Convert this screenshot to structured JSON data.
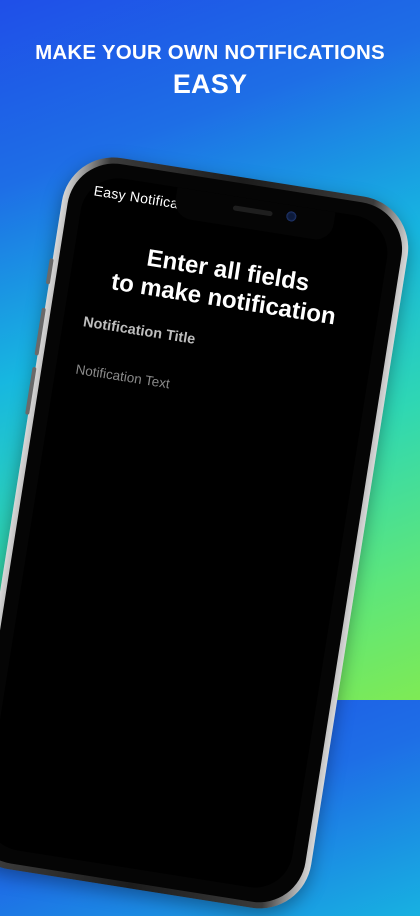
{
  "header": {
    "line1": "MAKE YOUR OWN NOTIFICATIONS",
    "line2": "EASY"
  },
  "app": {
    "title": "Easy Notification",
    "prompt_line1": "Enter all fields",
    "prompt_line2": "to make notification",
    "title_placeholder": "Notification Title",
    "text_placeholder": "Notification Text"
  },
  "colors": {
    "background_top": "#1f4fe8",
    "background_mid": "#17b7e0",
    "background_bottom": "#7eea55",
    "screen": "#000000",
    "text_primary": "#ffffff",
    "placeholder": "#8a8a8a"
  },
  "icons": {
    "camera": "front-camera-icon",
    "speaker": "earpiece-speaker-icon"
  }
}
